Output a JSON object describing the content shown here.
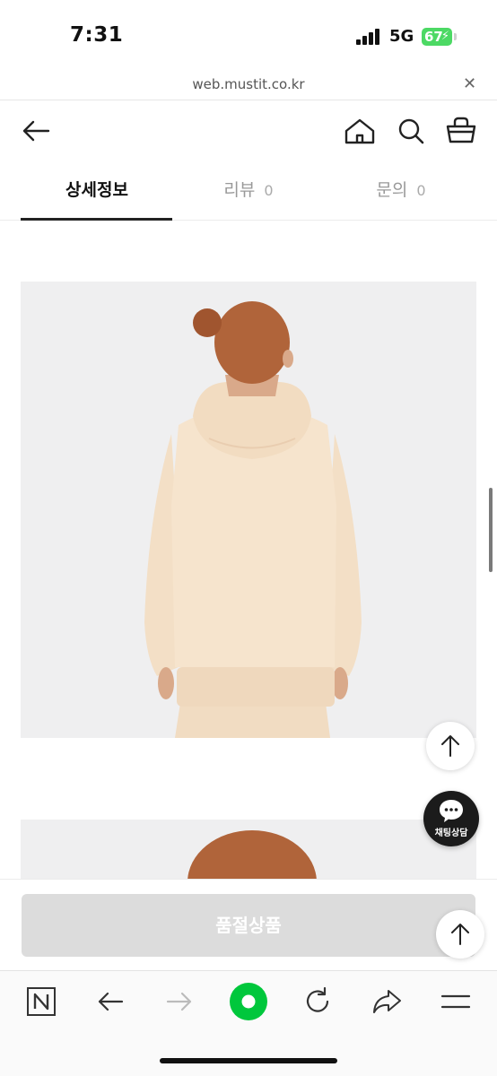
{
  "status_bar": {
    "time": "7:31",
    "network": "5G",
    "battery": "67"
  },
  "browser": {
    "url": "web.mustit.co.kr"
  },
  "header": {
    "back_icon": "arrow-left-icon",
    "home_icon": "home-icon",
    "search_icon": "search-icon",
    "cart_icon": "basket-icon"
  },
  "tabs": [
    {
      "label": "상세정보",
      "count": "",
      "active": true
    },
    {
      "label": "리뷰",
      "count": "0",
      "active": false
    },
    {
      "label": "문의",
      "count": "0",
      "active": false
    }
  ],
  "chat": {
    "label": "채팅상담"
  },
  "purchase": {
    "button_label": "품절상품"
  },
  "colors": {
    "accent": "#00c73c",
    "disabled": "#dcdcdc",
    "text": "#222222"
  }
}
